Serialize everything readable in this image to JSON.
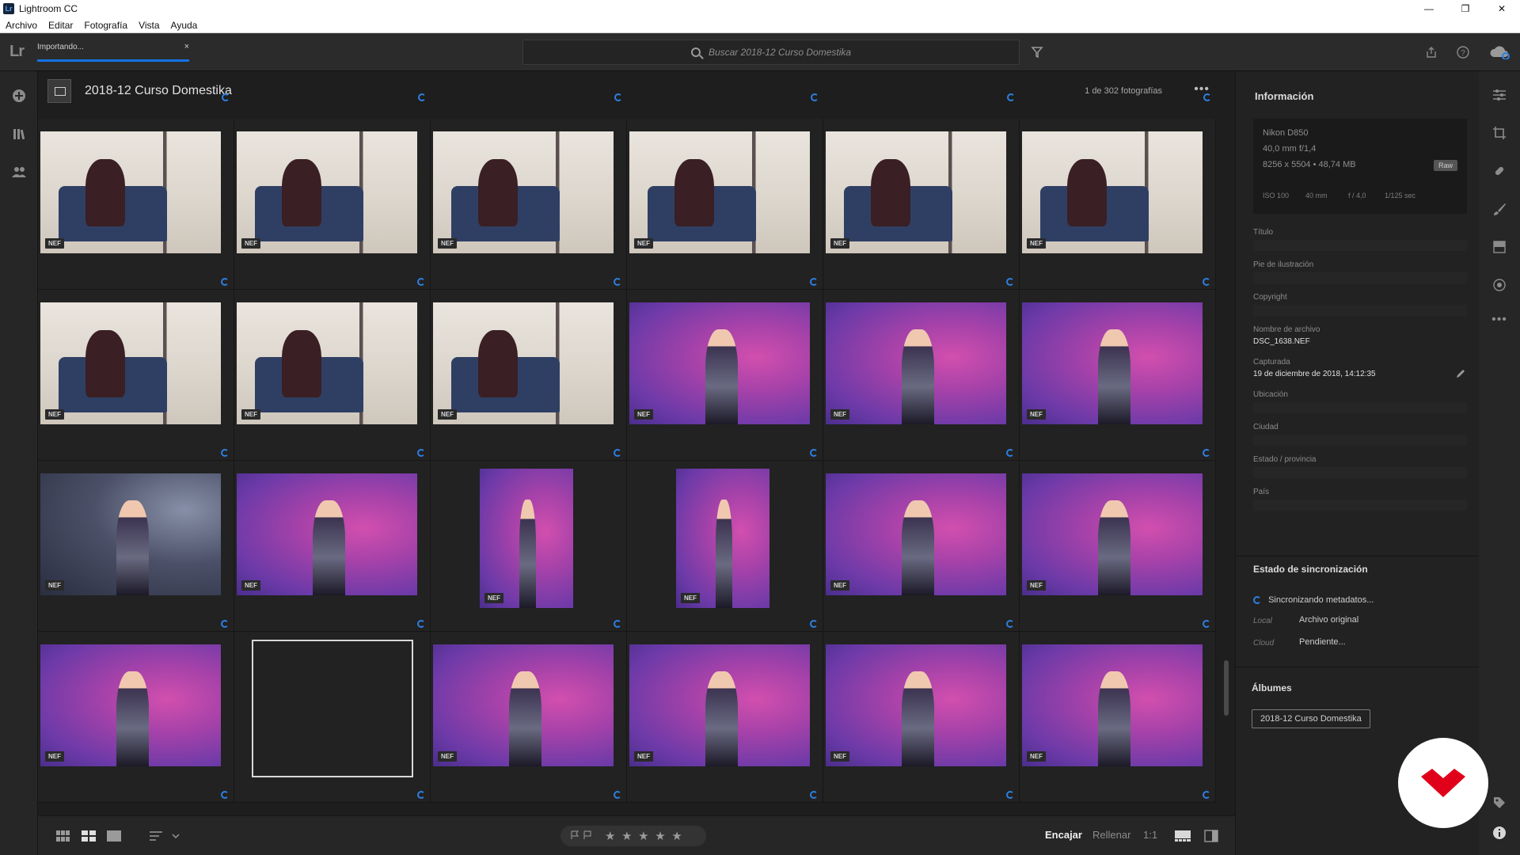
{
  "window": {
    "app_icon": "Lr",
    "title": "Lightroom CC",
    "controls": [
      "—",
      "❐",
      "✕"
    ]
  },
  "menu": [
    "Archivo",
    "Editar",
    "Fotografía",
    "Vista",
    "Ayuda"
  ],
  "toolbar": {
    "logo": "Lr",
    "import_label": "Importando...",
    "import_close": "×",
    "search_placeholder": "Buscar 2018-12 Curso Domestika"
  },
  "grid": {
    "album_title": "2018-12 Curso Domestika",
    "photo_count": "1 de 302 fotografías",
    "more": "•••",
    "badge_label": "NEF",
    "rows": [
      [
        "living",
        "living",
        "living",
        "living",
        "living",
        "living"
      ],
      [
        "living",
        "living",
        "living",
        "purple",
        "purple",
        "purple"
      ],
      [
        "dark",
        "purple",
        "purple",
        "purple",
        "purple",
        "purple"
      ],
      [
        "purple",
        "empty",
        "purple",
        "purple",
        "purple",
        "purple"
      ]
    ]
  },
  "info_panel": {
    "title": "Información",
    "camera": "Nikon D850",
    "lens": "40,0 mm f/1,4",
    "dimensions": "8256 x 5504  •  48,74 MB",
    "raw_badge": "Raw",
    "exposure": [
      "ISO 100",
      "40 mm",
      "f / 4,0",
      "1/125 sec"
    ],
    "fields": [
      {
        "label": "Título",
        "value": ""
      },
      {
        "label": "Pie de ilustración",
        "value": ""
      },
      {
        "label": "Copyright",
        "value": ""
      },
      {
        "label": "Nombre de archivo",
        "value": "DSC_1638.NEF"
      },
      {
        "label": "Capturada",
        "value": "19 de diciembre de 2018, 14:12:35"
      },
      {
        "label": "Ubicación",
        "value": ""
      },
      {
        "label": "Ciudad",
        "value": ""
      },
      {
        "label": "Estado / provincia",
        "value": ""
      },
      {
        "label": "País",
        "value": ""
      }
    ],
    "sync_title": "Estado de sincronización",
    "sync_status": "Sincronizando metadatos...",
    "local_label": "Local",
    "local_value": "Archivo original",
    "cloud_label": "Cloud",
    "cloud_value": "Pendiente...",
    "albums_title": "Álbumes",
    "album_chip": "2018-12 Curso Domestika"
  },
  "bottombar": {
    "fit": "Encajar",
    "fill": "Rellenar",
    "one_to_one": "1:1",
    "stars": [
      "★",
      "★",
      "★",
      "★",
      "★"
    ]
  },
  "colors": {
    "accent": "#1473e6",
    "sync": "#2d7fe0",
    "badge": "#e0001a"
  }
}
